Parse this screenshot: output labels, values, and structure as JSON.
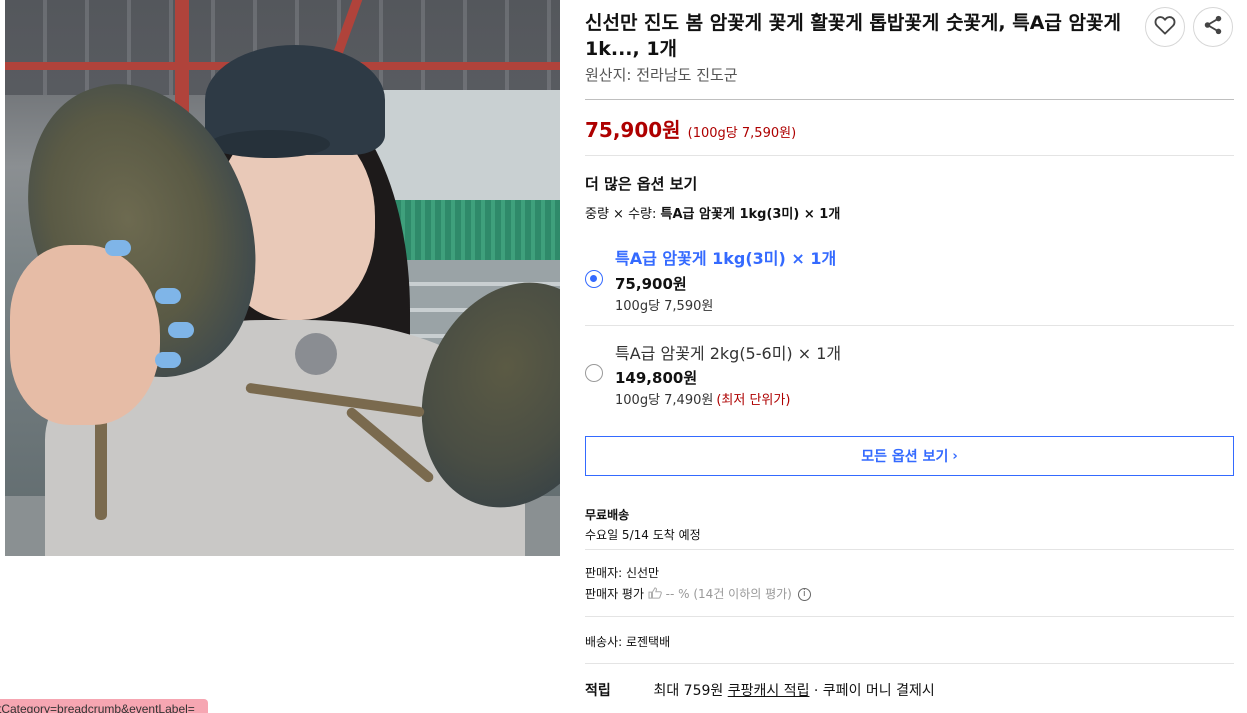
{
  "product": {
    "title": "신선만 진도 봄 암꽃게 꽃게 활꽃게 톱밥꽃게 숫꽃게, 특A급 암꽃게 1k..., 1개",
    "origin": "원산지: 전라남도 진도군",
    "price": "75,900원",
    "unit_price": "(100g당 7,590원)"
  },
  "actions": {
    "wishlist_icon": "heart-icon",
    "share_icon": "share-icon"
  },
  "options": {
    "heading": "더 많은 옵션 보기",
    "summary_prefix": "중량 × 수량:",
    "summary_value": "특A급 암꽃게 1kg(3미) × 1개",
    "items": [
      {
        "name": "특A급 암꽃게 1kg(3미) × 1개",
        "price": "75,900원",
        "unit": "100g당 7,590원",
        "note": "",
        "selected": true
      },
      {
        "name": "특A급 암꽃게 2kg(5-6미) × 1개",
        "price": "149,800원",
        "unit": "100g당 7,490원",
        "note": "(최저 단위가)",
        "selected": false
      }
    ],
    "all_options_label": "모든 옵션 보기",
    "all_options_chevron": "›"
  },
  "delivery": {
    "label": "무료배송",
    "eta": "수요일 5/14 도착 예정"
  },
  "seller": {
    "name": "판매자: 신선만",
    "rating_label": "판매자 평가",
    "rating_value": "-- % (14건 이하의 평가)",
    "info_icon": "i"
  },
  "courier": {
    "text": "배송사: 로젠택배"
  },
  "reward": {
    "label": "적립",
    "prefix": "최대 759원",
    "link": "쿠팡캐시 적립",
    "suffix": "· 쿠페이 머니 결제시"
  },
  "debug": {
    "tooltip": "tCategory=breadcrumb&eventLabel="
  },
  "colors": {
    "accent_blue": "#346aff",
    "price_red": "#ae0000"
  }
}
